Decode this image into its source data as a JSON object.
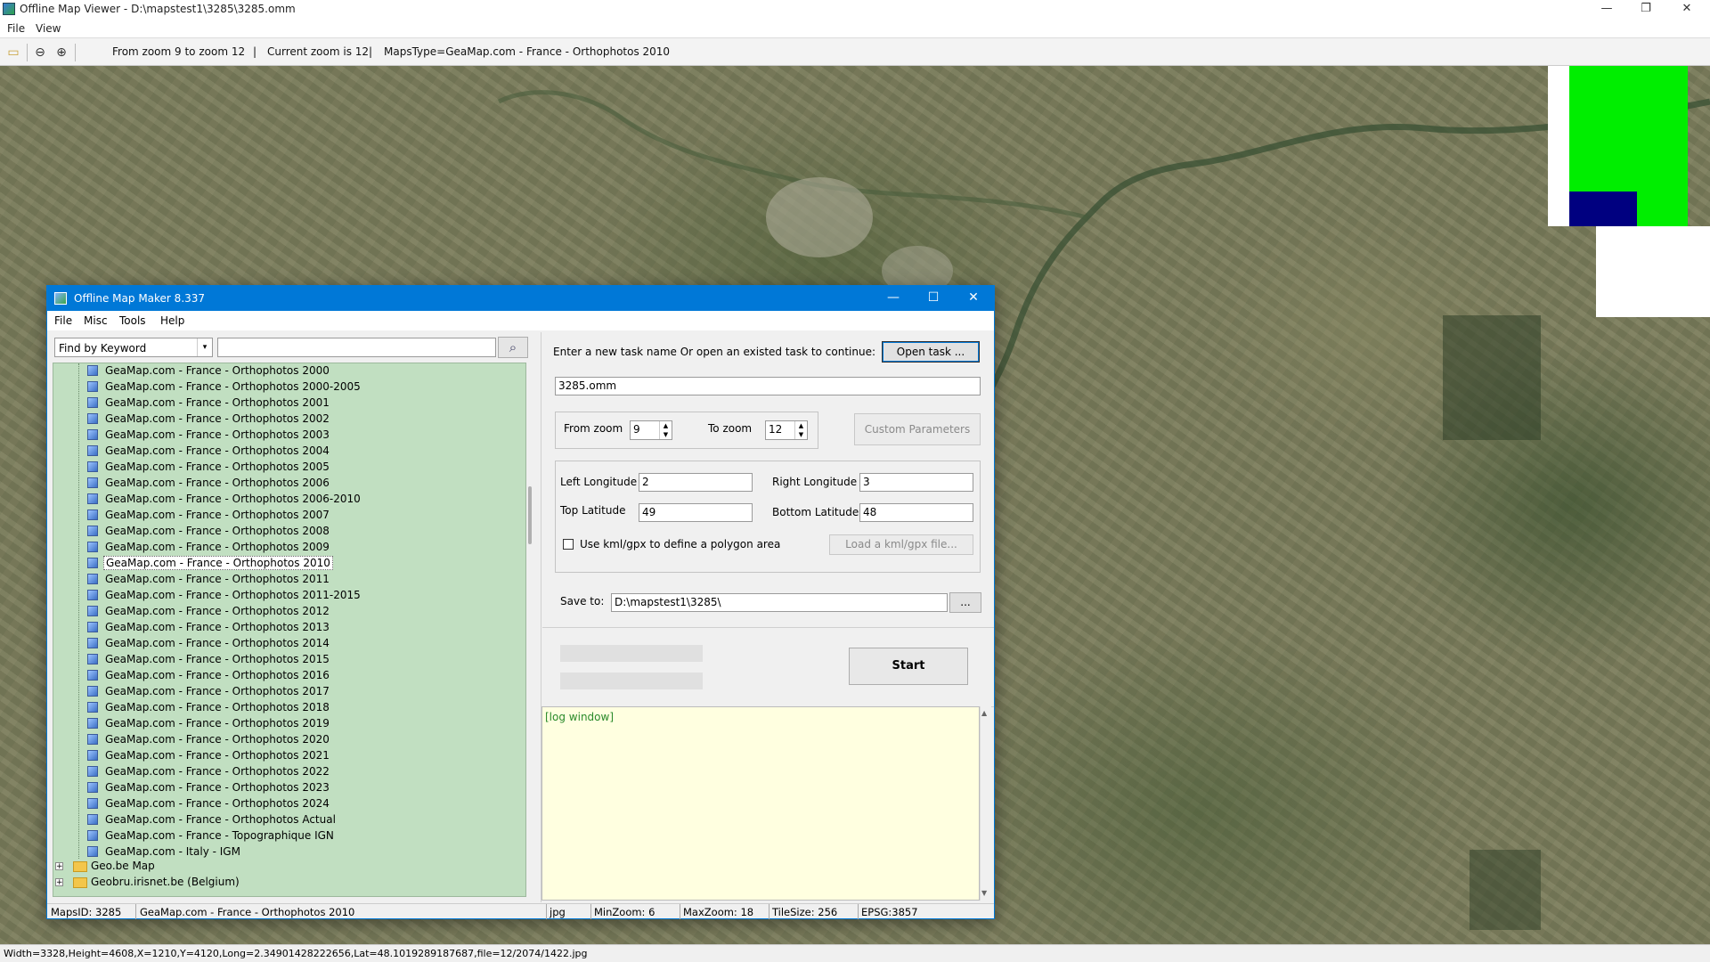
{
  "window": {
    "title": "Offline Map Viewer - D:\\mapstest1\\3285\\3285.omm",
    "controls": {
      "minimize": "—",
      "maximize": "❐",
      "close": "✕"
    }
  },
  "menu": [
    "File",
    "View"
  ],
  "toolbar": {
    "zoom_range": "From zoom 9 to zoom 12",
    "current_zoom": "Current zoom is 12",
    "maps_type": "MapsType=GeaMap.com - France - Orthophotos 2010",
    "sep1": "|",
    "sep2": "|",
    "icons": {
      "open": "folder-open-icon",
      "zoom_out": "zoom-out-icon",
      "zoom_in": "zoom-in-icon"
    }
  },
  "statusbar": "Width=3328,Height=4608,X=1210,Y=4120,Long=2.34901428222656,Lat=48.1019289187687,file=12/2074/1422.jpg",
  "dialog": {
    "title": "Offline Map Maker 8.337",
    "controls": {
      "minimize": "—",
      "maximize": "☐",
      "close": "✕"
    },
    "menu": [
      "File",
      "Misc",
      "Tools",
      "Help"
    ],
    "search": {
      "mode": "Find by Keyword",
      "query": "",
      "arrow": "▾",
      "button_icon": "⌕"
    },
    "tree": {
      "items": [
        "GeaMap.com - France - Orthophotos 2000",
        "GeaMap.com - France - Orthophotos 2000-2005",
        "GeaMap.com - France - Orthophotos 2001",
        "GeaMap.com - France - Orthophotos 2002",
        "GeaMap.com - France - Orthophotos 2003",
        "GeaMap.com - France - Orthophotos 2004",
        "GeaMap.com - France - Orthophotos 2005",
        "GeaMap.com - France - Orthophotos 2006",
        "GeaMap.com - France - Orthophotos 2006-2010",
        "GeaMap.com - France - Orthophotos 2007",
        "GeaMap.com - France - Orthophotos 2008",
        "GeaMap.com - France - Orthophotos 2009",
        "GeaMap.com - France - Orthophotos 2010",
        "GeaMap.com - France - Orthophotos 2011",
        "GeaMap.com - France - Orthophotos 2011-2015",
        "GeaMap.com - France - Orthophotos 2012",
        "GeaMap.com - France - Orthophotos 2013",
        "GeaMap.com - France - Orthophotos 2014",
        "GeaMap.com - France - Orthophotos 2015",
        "GeaMap.com - France - Orthophotos 2016",
        "GeaMap.com - France - Orthophotos 2017",
        "GeaMap.com - France - Orthophotos 2018",
        "GeaMap.com - France - Orthophotos 2019",
        "GeaMap.com - France - Orthophotos 2020",
        "GeaMap.com - France - Orthophotos 2021",
        "GeaMap.com - France - Orthophotos 2022",
        "GeaMap.com - France - Orthophotos 2023",
        "GeaMap.com - France - Orthophotos 2024",
        "GeaMap.com - France - Orthophotos Actual",
        "GeaMap.com - France - Topographique IGN",
        "GeaMap.com - Italy - IGM"
      ],
      "selected": "GeaMap.com - France - Orthophotos 2010",
      "folders": [
        "Geo.be Map",
        "Geobru.irisnet.be (Belgium)"
      ],
      "expand_glyph": "+"
    },
    "task": {
      "prompt": "Enter a new task name Or open an existed task to continue:",
      "open_button": "Open task ...",
      "name": "3285.omm"
    },
    "zoom": {
      "from_label": "From zoom",
      "from_value": "9",
      "to_label": "To zoom",
      "to_value": "12",
      "up": "▲",
      "down": "▼",
      "custom_button": "Custom Parameters"
    },
    "bounds": {
      "left_label": "Left Longitude",
      "left": "2",
      "right_label": "Right Longitude",
      "right": "3",
      "top_label": "Top Latitude",
      "top": "49",
      "bottom_label": "Bottom Latitude",
      "bottom": "48",
      "kml_label": "Use kml/gpx to define a polygon area",
      "kml_button": "Load a kml/gpx file..."
    },
    "save": {
      "label": "Save to:",
      "path": "D:\\mapstest1\\3285\\",
      "browse": "..."
    },
    "start_button": "Start",
    "log": {
      "text": "[log window]",
      "up": "▲",
      "down": "▼"
    },
    "status": {
      "mapsid": "MapsID: 3285",
      "mapname": "GeaMap.com - France - Orthophotos 2010",
      "format": "jpg",
      "minzoom": "MinZoom: 6",
      "maxzoom": "MaxZoom: 18",
      "tilesize": "TileSize: 256",
      "epsg": "EPSG:3857"
    }
  },
  "colors": {
    "tile_green": "#00ee00",
    "tile_navy": "#000080",
    "title_blue": "#0078d7",
    "tree_bg": "#c1dfc1",
    "log_bg": "#ffffe0"
  }
}
